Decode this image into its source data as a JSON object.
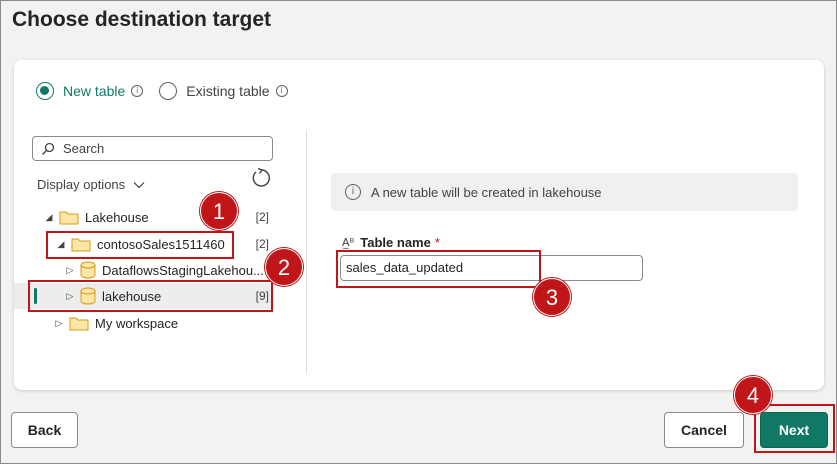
{
  "dialog": {
    "title": "Choose destination target",
    "options": {
      "new_table": "New table",
      "existing_table": "Existing table",
      "selected": "new_table"
    },
    "search": {
      "placeholder": "Search"
    },
    "display_options": "Display options",
    "tree": [
      {
        "label": "Lakehouse",
        "count": "[2]",
        "expanded": true,
        "icon": "folder-icon"
      },
      {
        "label": "contosoSales1511460",
        "count": "[2]",
        "expanded": true,
        "icon": "folder-icon"
      },
      {
        "label": "DataflowsStagingLakehou...",
        "count": "",
        "expanded": false,
        "icon": "database-icon"
      },
      {
        "label": "lakehouse",
        "count": "[9]",
        "expanded": false,
        "icon": "database-icon",
        "selected": true
      },
      {
        "label": "My workspace",
        "count": "",
        "expanded": false,
        "icon": "folder-icon"
      }
    ],
    "info_message": "A new table will be created in lakehouse",
    "table_name_label": "Table name",
    "required_marker": "*",
    "table_name_value": "sales_data_updated",
    "buttons": {
      "back": "Back",
      "cancel": "Cancel",
      "next": "Next"
    },
    "callouts": [
      "1",
      "2",
      "3",
      "4"
    ]
  },
  "colors": {
    "accent": "#117865",
    "callout": "#c0161a"
  }
}
